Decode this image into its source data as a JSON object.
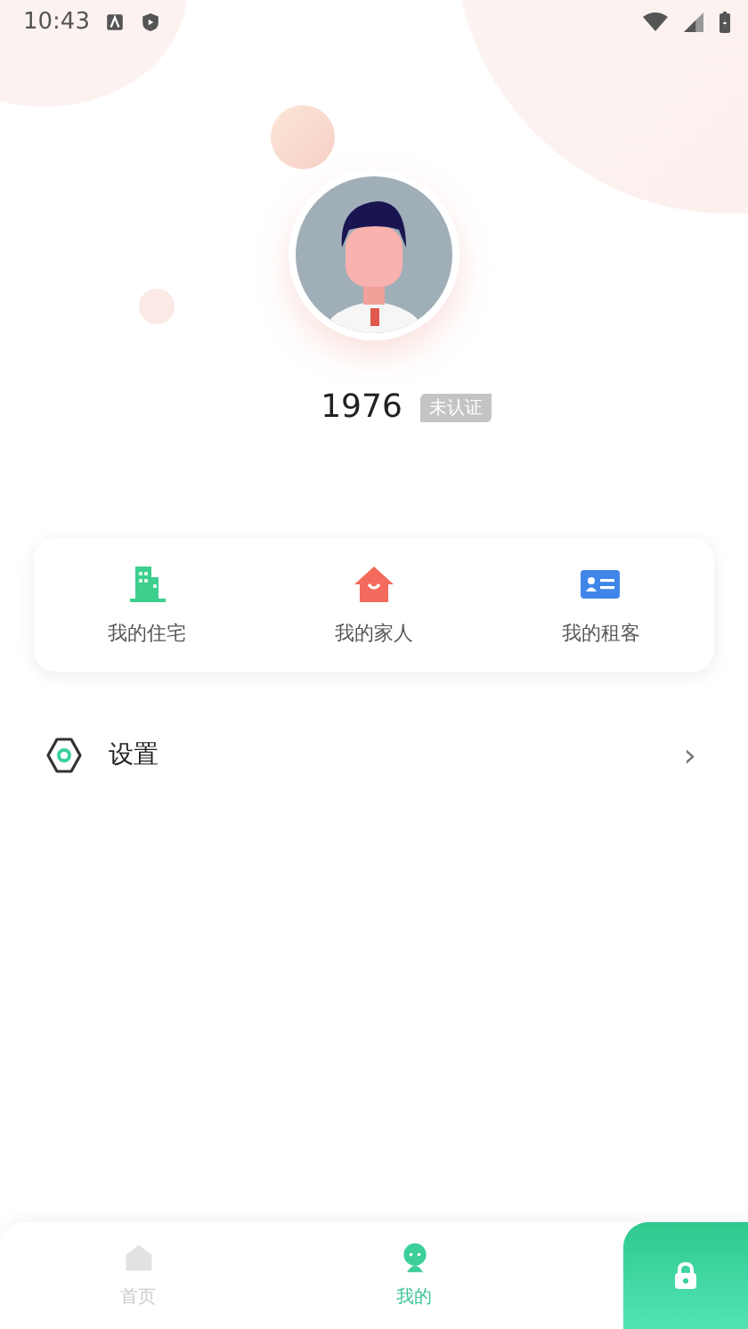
{
  "status_bar": {
    "time": "10:43"
  },
  "profile": {
    "name": "1976",
    "badge": "未认证"
  },
  "shortcuts": [
    {
      "kind": "building",
      "label": "我的住宅"
    },
    {
      "kind": "house",
      "label": "我的家人"
    },
    {
      "kind": "card",
      "label": "我的租客"
    }
  ],
  "menu": [
    {
      "label": "设置",
      "chevron": "›"
    }
  ],
  "tabs": [
    {
      "kind": "home",
      "label": "首页",
      "selected": false
    },
    {
      "kind": "me",
      "label": "我的",
      "selected": true
    }
  ]
}
